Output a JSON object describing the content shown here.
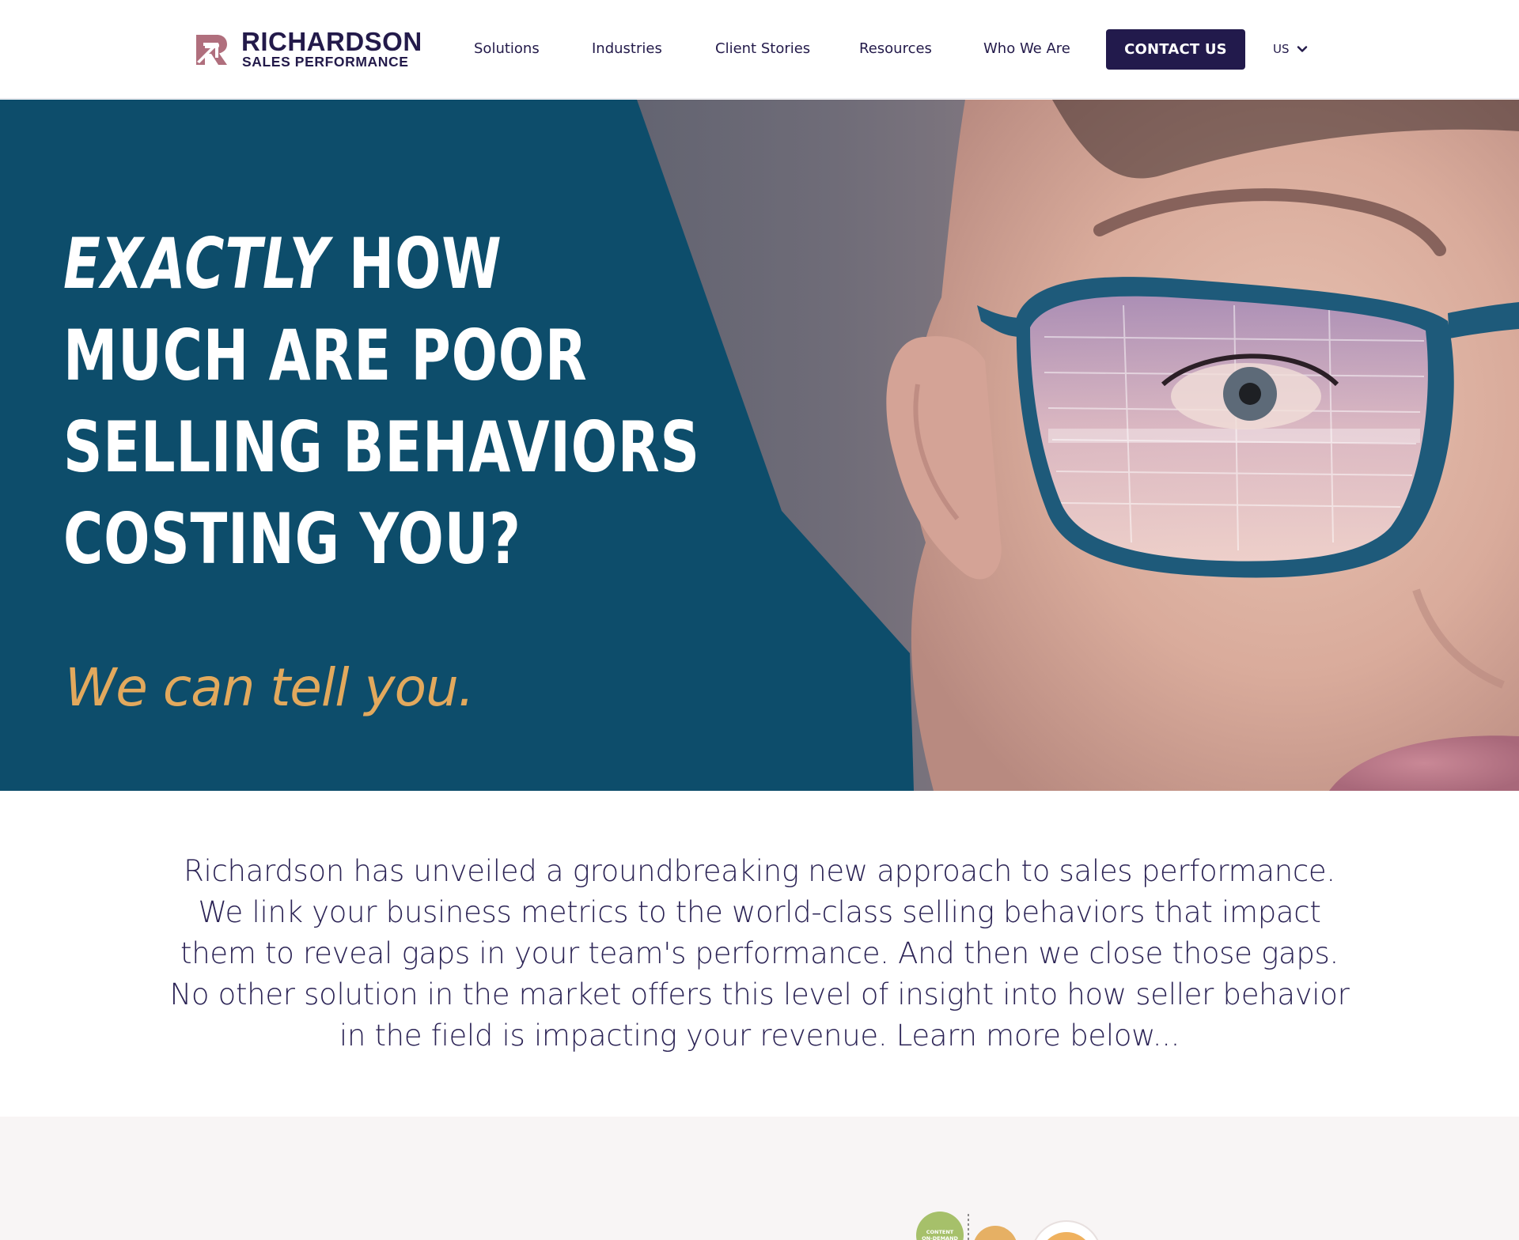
{
  "brand": {
    "name": "RICHARDSON",
    "subtitle": "SALES PERFORMANCE",
    "mark_color": "#b06f7d",
    "primary_color": "#231a4a"
  },
  "nav": {
    "items": [
      {
        "label": "Solutions"
      },
      {
        "label": "Industries"
      },
      {
        "label": "Client Stories"
      },
      {
        "label": "Resources"
      },
      {
        "label": "Who We Are"
      }
    ],
    "cta_label": "CONTACT US",
    "locale": "US",
    "locale_icon": "chevron-down-icon"
  },
  "hero": {
    "headline_emphasis": "EXACTLY",
    "headline_line1_rest": "HOW",
    "headline_line2": "MUCH ARE POOR",
    "headline_line3": "SELLING BEHAVIORS",
    "headline_line4": "COSTING YOU?",
    "tagline": "We can tell you.",
    "panel_color": "#0d4d6b",
    "tagline_color": "#e2a95d",
    "image": "woman-with-glasses-reflecting-financial-data"
  },
  "intro": {
    "text": "Richardson has unveiled a groundbreaking new approach to sales performance. We link your business metrics to the world-class selling behaviors that impact them to reveal gaps in your team's performance. And then we close those gaps. No other solution in the market offers this level of insight into how seller behavior in the field is impacting your revenue. Learn more below..."
  },
  "next_section": {
    "badge_text": "CONTENT ON-DEMAND"
  }
}
